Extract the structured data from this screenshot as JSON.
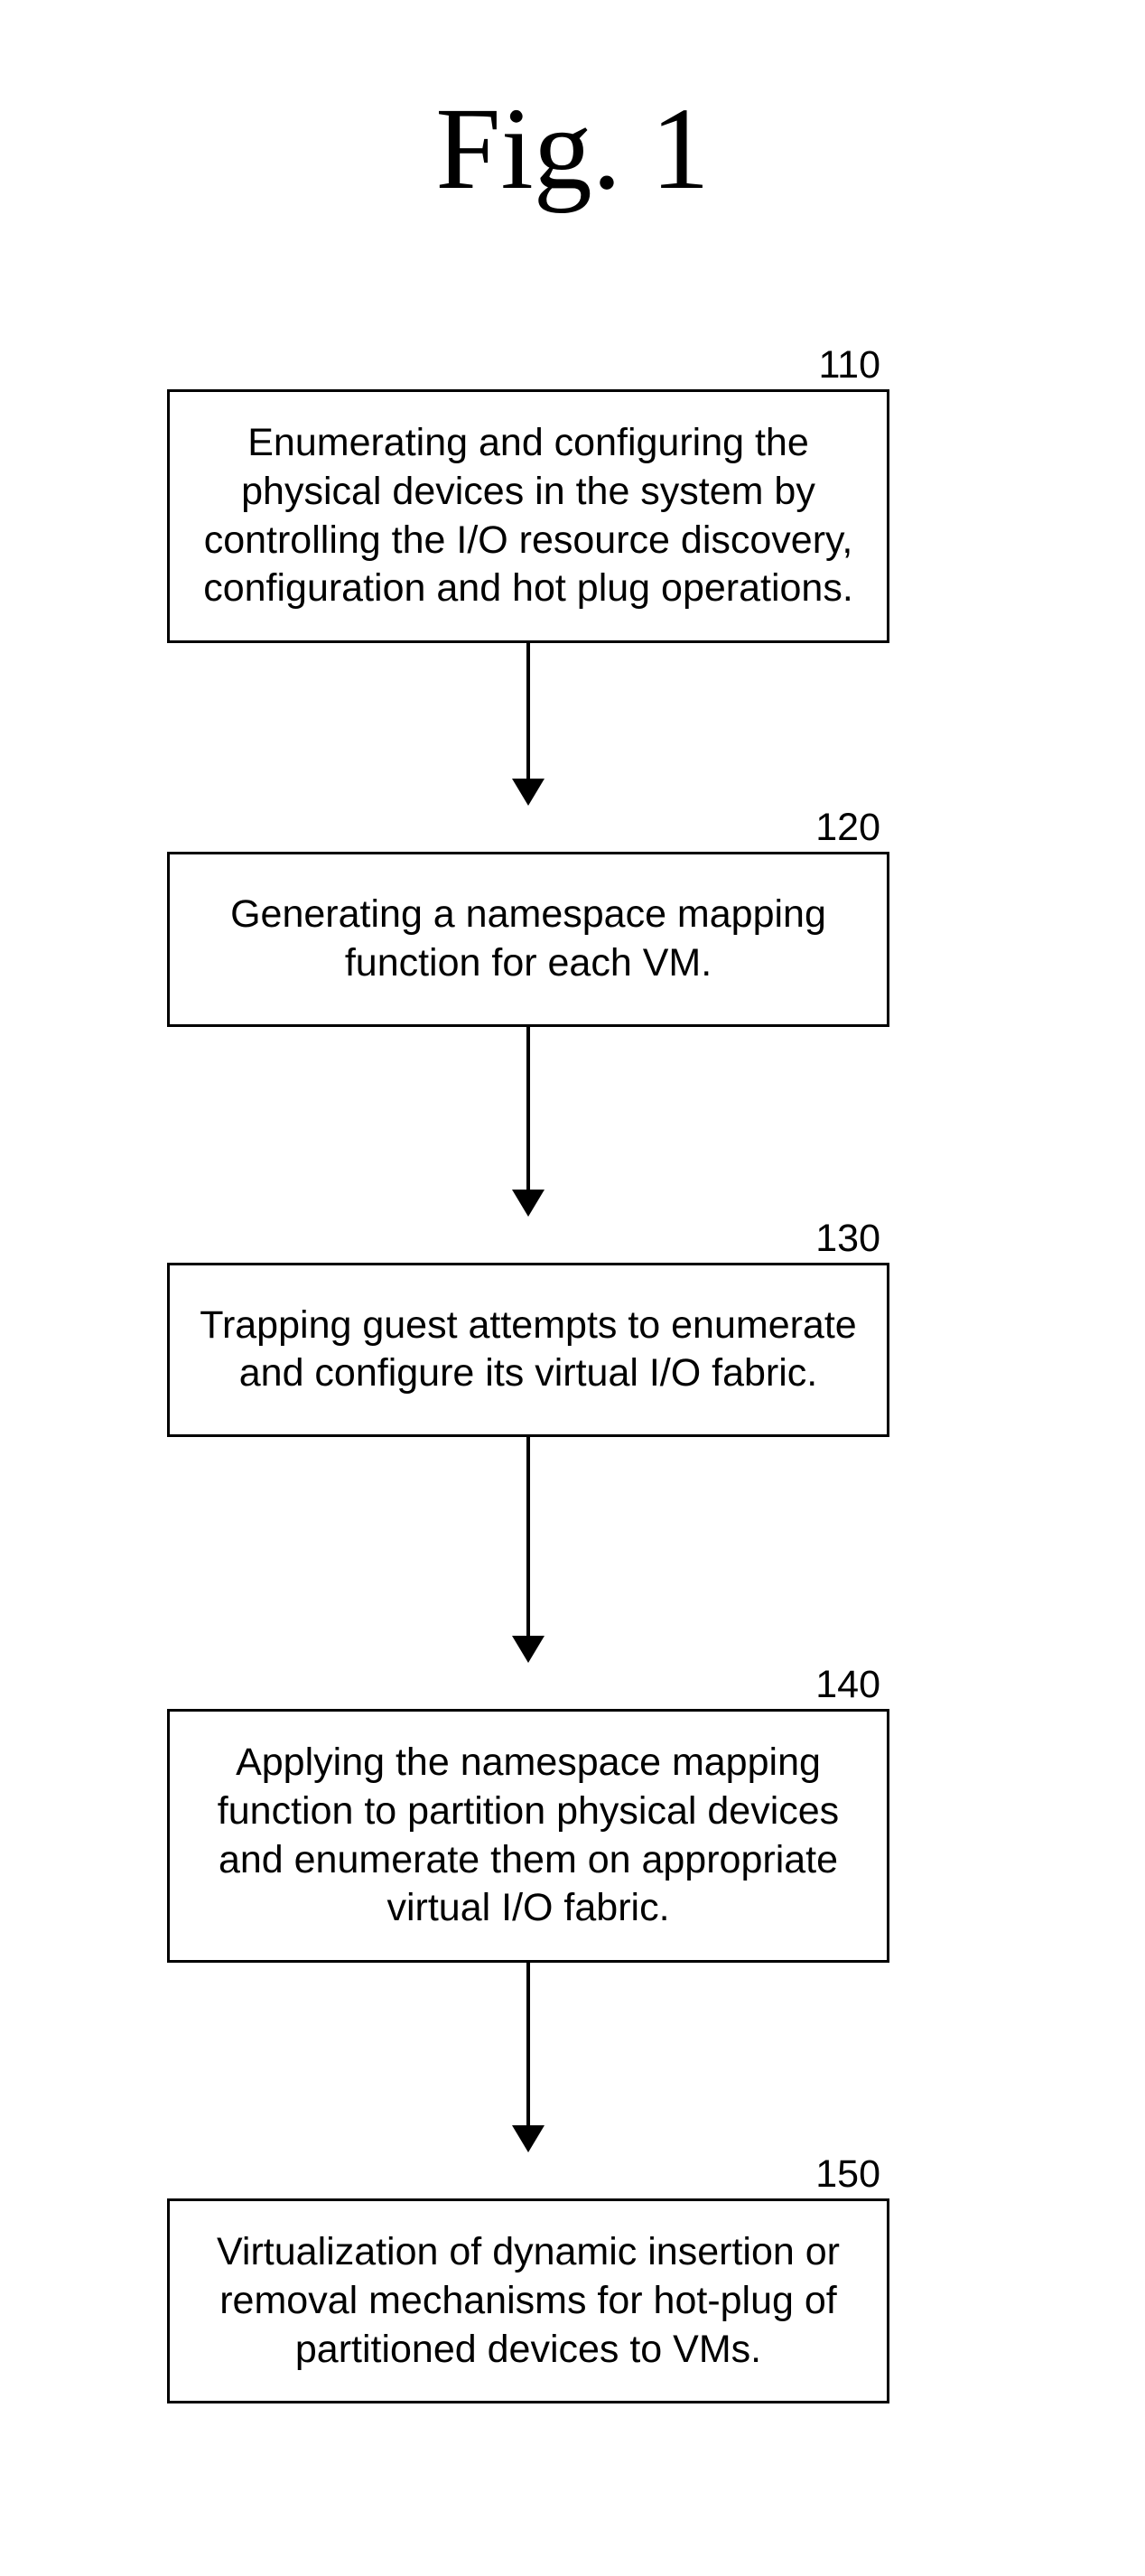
{
  "figure": {
    "title": "Fig. 1",
    "steps": [
      {
        "id": "110",
        "text": "Enumerating and configuring the physical devices in the system by controlling the I/O resource discovery, configuration and hot plug operations."
      },
      {
        "id": "120",
        "text": "Generating a namespace mapping function for each VM."
      },
      {
        "id": "130",
        "text": "Trapping guest attempts to enumerate and configure its virtual I/O fabric."
      },
      {
        "id": "140",
        "text": "Applying the namespace mapping function to partition physical devices and enumerate them on appropriate virtual I/O fabric."
      },
      {
        "id": "150",
        "text": "Virtualization of dynamic insertion or removal mechanisms for hot-plug of partitioned devices to VMs."
      }
    ]
  }
}
